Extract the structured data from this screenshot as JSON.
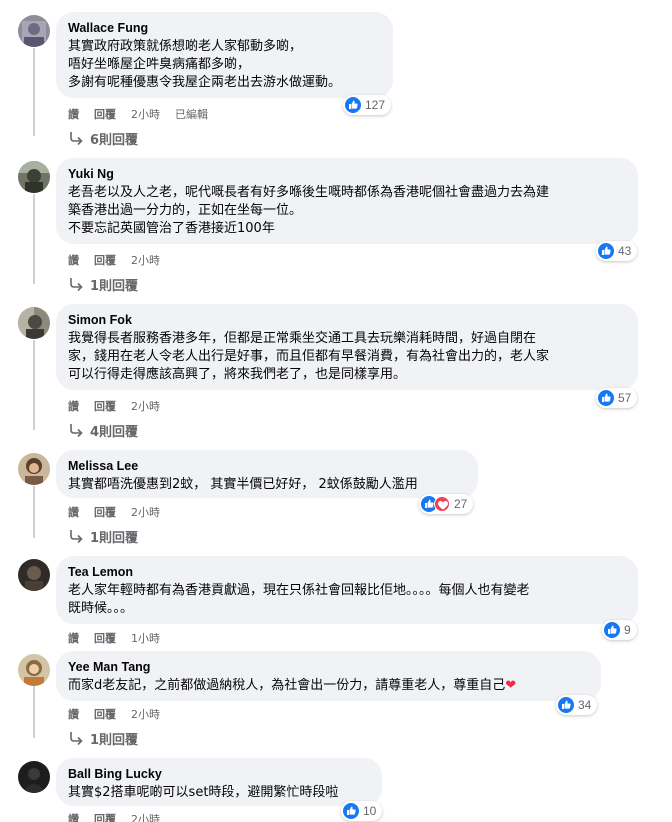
{
  "comments": [
    {
      "author": "Wallace Fung",
      "text": "其實政府政策就係想啲老人家郁動多啲，\n唔好坐喺屋企吽臭病痛都多啲，\n多謝有呢種優惠令我屋企兩老出去游水做運動。",
      "reactions": "127",
      "actions": {
        "like": "讚",
        "reply": "回覆",
        "time": "2小時",
        "edited": "已編輯"
      },
      "replies": "6則回覆"
    },
    {
      "author": "Yuki Ng",
      "text": "老吾老以及人之老，呢代嘅長者有好多喺後生嘅時都係為香港呢個社會盡過力去為建\n築香港出過一分力的，正如在坐每一位。\n不要忘記英國管治了香港接近100年",
      "reactions": "43",
      "actions": {
        "like": "讚",
        "reply": "回覆",
        "time": "2小時"
      },
      "replies": "1則回覆"
    },
    {
      "author": "Simon Fok",
      "text": "我覺得長者服務香港多年，佢都是正常乘坐交通工具去玩樂消耗時間，好過自閉在\n家，錢用在老人令老人出行是好事，而且佢都有早餐消費，有為社會出力的，老人家\n可以行得走得應該高興了，將來我們老了，也是同樣享用。",
      "reactions": "57",
      "actions": {
        "like": "讚",
        "reply": "回覆",
        "time": "2小時"
      },
      "replies": "4則回覆"
    },
    {
      "author": "Melissa Lee",
      "text": "其實都唔洗優惠到2蚊，  其實半價已好好，  2蚊係鼓勵人濫用",
      "reactions": "27",
      "actions": {
        "like": "讚",
        "reply": "回覆",
        "time": "2小時"
      },
      "replies": "1則回覆"
    },
    {
      "author": "Tea Lemon",
      "text": "老人家年輕時都有為香港貢獻過，現在只係社會回報比佢地。。。。每個人也有變老\n既時候。。。",
      "reactions": "9",
      "actions": {
        "like": "讚",
        "reply": "回覆",
        "time": "1小時"
      }
    },
    {
      "author": "Yee Man Tang",
      "text": "而家d老友記，之前都做過納稅人，為社會出一份力，請尊重老人，尊重自己",
      "reactions": "34",
      "actions": {
        "like": "讚",
        "reply": "回覆",
        "time": "2小時"
      },
      "replies": "1則回覆"
    },
    {
      "author": "Ball Bing Lucky",
      "text": "其實$2搭車呢啲可以set時段，避開繁忙時段啦",
      "reactions": "10",
      "actions": {
        "like": "讚",
        "reply": "回覆",
        "time": "2小時"
      }
    }
  ],
  "icons": {
    "like": "like-icon",
    "love": "love-icon",
    "reply_arrow": "reply-arrow-icon",
    "heart_emoji": "heart-icon"
  },
  "colors": {
    "bubble": "#f0f2f5",
    "like_blue": "#1877f2",
    "love_red": "#f33e58",
    "meta_gray": "#65676b",
    "text": "#050505"
  }
}
